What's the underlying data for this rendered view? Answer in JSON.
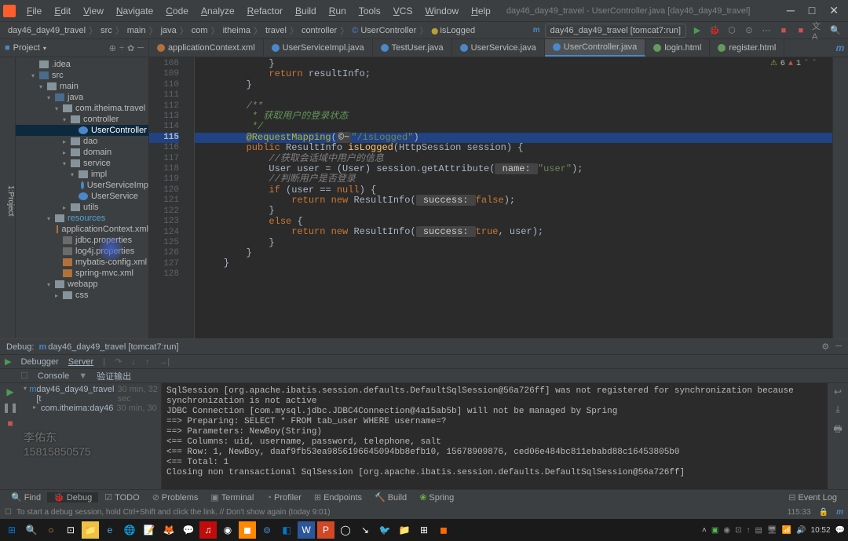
{
  "window": {
    "title": "day46_day49_travel - UserController.java [day46_day49_travel]"
  },
  "menu": [
    "File",
    "Edit",
    "View",
    "Navigate",
    "Code",
    "Analyze",
    "Refactor",
    "Build",
    "Run",
    "Tools",
    "VCS",
    "Window",
    "Help"
  ],
  "breadcrumb": [
    "day46_day49_travel",
    "src",
    "main",
    "java",
    "com",
    "itheima",
    "travel",
    "controller",
    "UserController",
    "isLogged"
  ],
  "run_config": "day46_day49_travel [tomcat7:run]",
  "project_header": "Project",
  "tree": {
    "items": [
      {
        "indent": 2,
        "arrow": "",
        "label": ".idea",
        "icon": "folder-icon"
      },
      {
        "indent": 2,
        "arrow": "▾",
        "label": "src",
        "icon": "folder-blue"
      },
      {
        "indent": 3,
        "arrow": "▾",
        "label": "main",
        "icon": "folder-icon"
      },
      {
        "indent": 4,
        "arrow": "▾",
        "label": "java",
        "icon": "folder-blue"
      },
      {
        "indent": 5,
        "arrow": "▾",
        "label": "com.itheima.travel",
        "icon": "folder-icon"
      },
      {
        "indent": 6,
        "arrow": "▾",
        "label": "controller",
        "icon": "folder-icon"
      },
      {
        "indent": 7,
        "arrow": "",
        "label": "UserController",
        "icon": "class-icon",
        "selected": true
      },
      {
        "indent": 6,
        "arrow": "▸",
        "label": "dao",
        "icon": "folder-icon"
      },
      {
        "indent": 6,
        "arrow": "▸",
        "label": "domain",
        "icon": "folder-icon"
      },
      {
        "indent": 6,
        "arrow": "▾",
        "label": "service",
        "icon": "folder-icon"
      },
      {
        "indent": 7,
        "arrow": "▾",
        "label": "impl",
        "icon": "folder-icon"
      },
      {
        "indent": 8,
        "arrow": "",
        "label": "UserServiceImp",
        "icon": "class-icon"
      },
      {
        "indent": 7,
        "arrow": "",
        "label": "UserService",
        "icon": "class-icon"
      },
      {
        "indent": 6,
        "arrow": "▸",
        "label": "utils",
        "icon": "folder-icon"
      },
      {
        "indent": 4,
        "arrow": "▾",
        "label": "resources",
        "icon": "folder-icon",
        "emph": true
      },
      {
        "indent": 5,
        "arrow": "",
        "label": "applicationContext.xml",
        "icon": "xml-ficon"
      },
      {
        "indent": 5,
        "arrow": "",
        "label": "jdbc.properties",
        "icon": "prop-icon"
      },
      {
        "indent": 5,
        "arrow": "",
        "label": "log4j.properties",
        "icon": "prop-icon"
      },
      {
        "indent": 5,
        "arrow": "",
        "label": "mybatis-config.xml",
        "icon": "xml-ficon"
      },
      {
        "indent": 5,
        "arrow": "",
        "label": "spring-mvc.xml",
        "icon": "xml-ficon"
      },
      {
        "indent": 4,
        "arrow": "▾",
        "label": "webapp",
        "icon": "folder-icon"
      },
      {
        "indent": 5,
        "arrow": "▸",
        "label": "css",
        "icon": "folder-icon"
      }
    ]
  },
  "tabs": [
    {
      "label": "applicationContext.xml",
      "icon": "xml-icon"
    },
    {
      "label": "UserServiceImpl.java",
      "icon": "java-icon"
    },
    {
      "label": "TestUser.java",
      "icon": "java-icon"
    },
    {
      "label": "UserService.java",
      "icon": "java-icon"
    },
    {
      "label": "UserController.java",
      "icon": "java-icon",
      "active": true
    },
    {
      "label": "login.html",
      "icon": "html-icon"
    },
    {
      "label": "register.html",
      "icon": "html-icon"
    }
  ],
  "editor_status": {
    "yellow": "6",
    "red": "1"
  },
  "code": {
    "start": 108,
    "lines": [
      "            }",
      "            __kw__return__end__ resultInfo;",
      "        }",
      "",
      "        __cmt__/**__end__",
      "__cmtg__         * 获取用户的登录状态__end__",
      "__cmtg__         */__end__",
      "__hl__        __ann__@RequestMapping__end__(__param__©~__end____str__\"/isLogged\"__end__)",
      "        __kw__public __end__ResultInfo __fn__isLogged__end__(HttpSession session) {",
      "            __cmt__//获取会话域中用户的信息__end__",
      "            User user = (User) session.getAttribute(__param2__ name: __end____str__\"user\"__end__);",
      "            __cmt__//判断用户是否登录__end__",
      "            __kw__if __end__(user == __kw__null__end__) {",
      "                __kw__return new __end__ResultInfo(__param2__ success: __end____kw__false__end__);",
      "            }",
      "            __kw__else __end__{",
      "                __kw__return new __end__ResultInfo(__param2__ success: __end____kw__true__end__, user);",
      "            }",
      "        }",
      "    }",
      ""
    ]
  },
  "debug": {
    "title": "Debug:",
    "config": "day46_day49_travel [tomcat7:run]",
    "tab_debugger": "Debugger",
    "tab_server": "Server",
    "tab_console": "Console",
    "tab_verify": "验证输出",
    "frame1": "day46_day49_travel [t",
    "frame1_time": "30 min, 32 sec",
    "frame2": "com.itheima:day46",
    "frame2_time": "30 min, 30"
  },
  "console": [
    "SqlSession [org.apache.ibatis.session.defaults.DefaultSqlSession@56a726ff] was not registered for synchronization because synchronization is not active",
    "JDBC Connection [com.mysql.jdbc.JDBC4Connection@4a15ab5b] will not be managed by Spring",
    "==>  Preparing: SELECT * FROM tab_user WHERE username=?",
    "==> Parameters: NewBoy(String)",
    "<==    Columns: uid, username, password, telephone, salt",
    "<==        Row: 1, NewBoy, daaf9fb53ea9856196645094bb8efb10, 15678909876, ced06e484bc811ebabd88c16453805b0",
    "<==      Total: 1",
    "Closing non transactional SqlSession [org.apache.ibatis.session.defaults.DefaultSqlSession@56a726ff]"
  ],
  "watermark": {
    "name": "李佑东",
    "phone": "15815850575"
  },
  "bottom_tools": {
    "find": "Find",
    "debug": "Debug",
    "todo": "TODO",
    "problems": "Problems",
    "terminal": "Terminal",
    "profiler": "Profiler",
    "endpoints": "Endpoints",
    "build": "Build",
    "spring": "Spring",
    "eventlog": "Event Log"
  },
  "status": {
    "msg": "To start a debug session, hold Ctrl+Shift and click the link. // Don't show again (today 9:01)",
    "pos": "115:33"
  },
  "clock": "10:52"
}
